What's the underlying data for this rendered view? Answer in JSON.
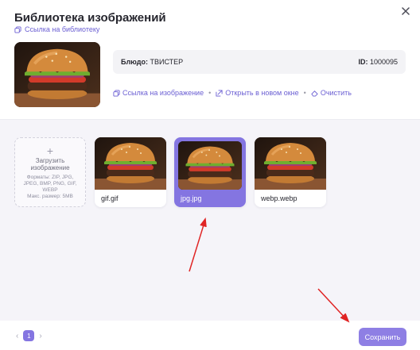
{
  "dialog": {
    "title": "Библиотека изображений",
    "library_link": "Ссылка на библиотеку",
    "close_icon": "close-icon"
  },
  "info": {
    "dish_label": "Блюдо:",
    "dish_value": "ТВИСТЕР",
    "id_label": "ID:",
    "id_value": "1000095"
  },
  "actions": {
    "image_link": "Ссылка на изображение",
    "open_new_window": "Открыть в новом окне",
    "clear": "Очистить",
    "separator": "•"
  },
  "upload": {
    "plus": "+",
    "title": "Загрузить изображение",
    "formats": "Форматы: ZIP, JPG, JPEG, BMP, PNG, GIF, WEBP",
    "max_size": "Макс. размер: 5MB"
  },
  "images": [
    {
      "name": "gif.gif",
      "selected": false
    },
    {
      "name": "jpg.jpg",
      "selected": true
    },
    {
      "name": "webp.webp",
      "selected": false
    }
  ],
  "pagination": {
    "prev": "‹",
    "current": "1",
    "next": "›"
  },
  "footer": {
    "save_label": "Сохранить"
  },
  "colors": {
    "accent": "#8475e1",
    "link": "#6b5fd3",
    "annotation_arrow": "#e02424"
  }
}
